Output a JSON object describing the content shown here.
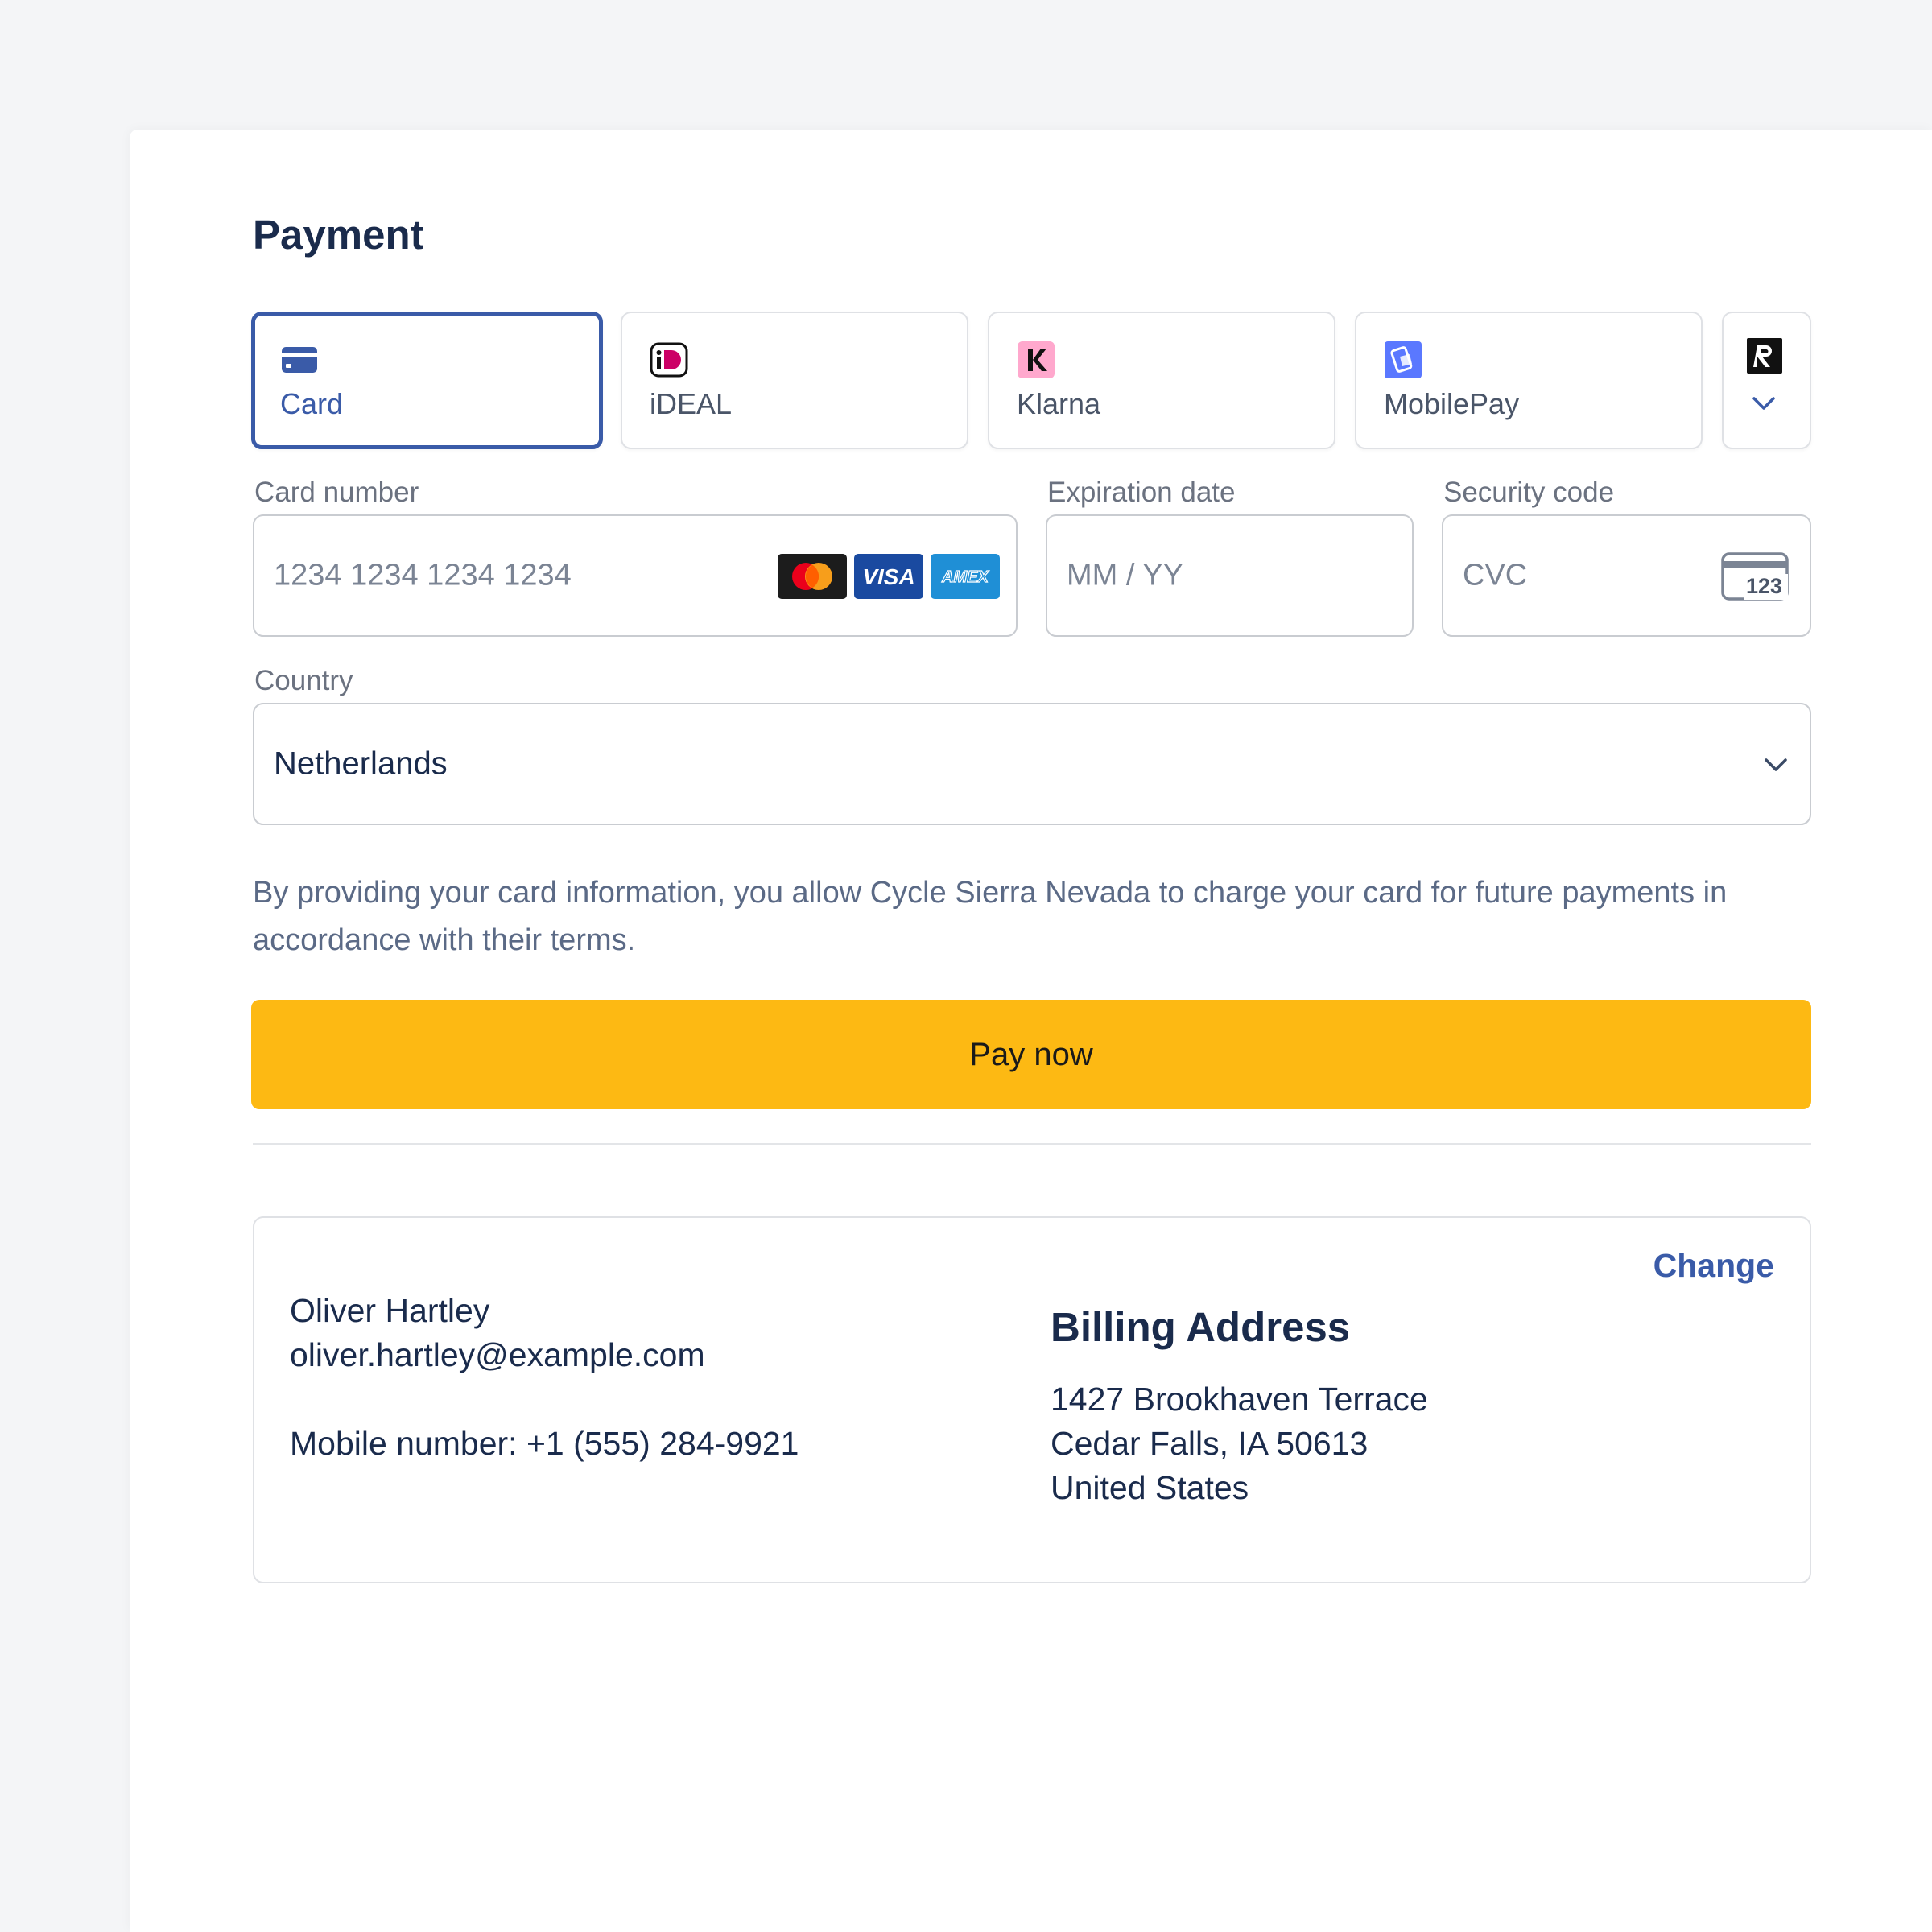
{
  "payment": {
    "title": "Payment",
    "tabs": [
      {
        "label": "Card",
        "icon": "card-icon",
        "selected": true
      },
      {
        "label": "iDEAL",
        "icon": "ideal-icon",
        "selected": false
      },
      {
        "label": "Klarna",
        "icon": "klarna-icon",
        "selected": false
      },
      {
        "label": "MobilePay",
        "icon": "mobilepay-icon",
        "selected": false
      }
    ],
    "more_tab": {
      "icon": "revolut-icon"
    },
    "card_number": {
      "label": "Card number",
      "placeholder": "1234 1234 1234 1234",
      "brands": [
        "mastercard",
        "visa",
        "amex"
      ]
    },
    "expiration": {
      "label": "Expiration date",
      "placeholder": "MM / YY"
    },
    "security": {
      "label": "Security code",
      "placeholder": "CVC",
      "icon_text": "123"
    },
    "country": {
      "label": "Country",
      "value": "Netherlands"
    },
    "notice": "By providing your card information, you allow Cycle Sierra Nevada to charge your card for future payments in accordance with their terms.",
    "pay_button": "Pay now",
    "colors": {
      "accent": "#3a5ba8",
      "pay_button": "#fdb913",
      "text": "#1a2b4c"
    }
  },
  "summary": {
    "name": "Oliver Hartley",
    "email": "oliver.hartley@example.com",
    "mobile": "Mobile number: +1 (555) 284-9921",
    "change_label": "Change",
    "billing_heading": "Billing Address",
    "address_lines": [
      "1427 Brookhaven Terrace",
      "Cedar Falls, IA 50613",
      "United States"
    ]
  }
}
